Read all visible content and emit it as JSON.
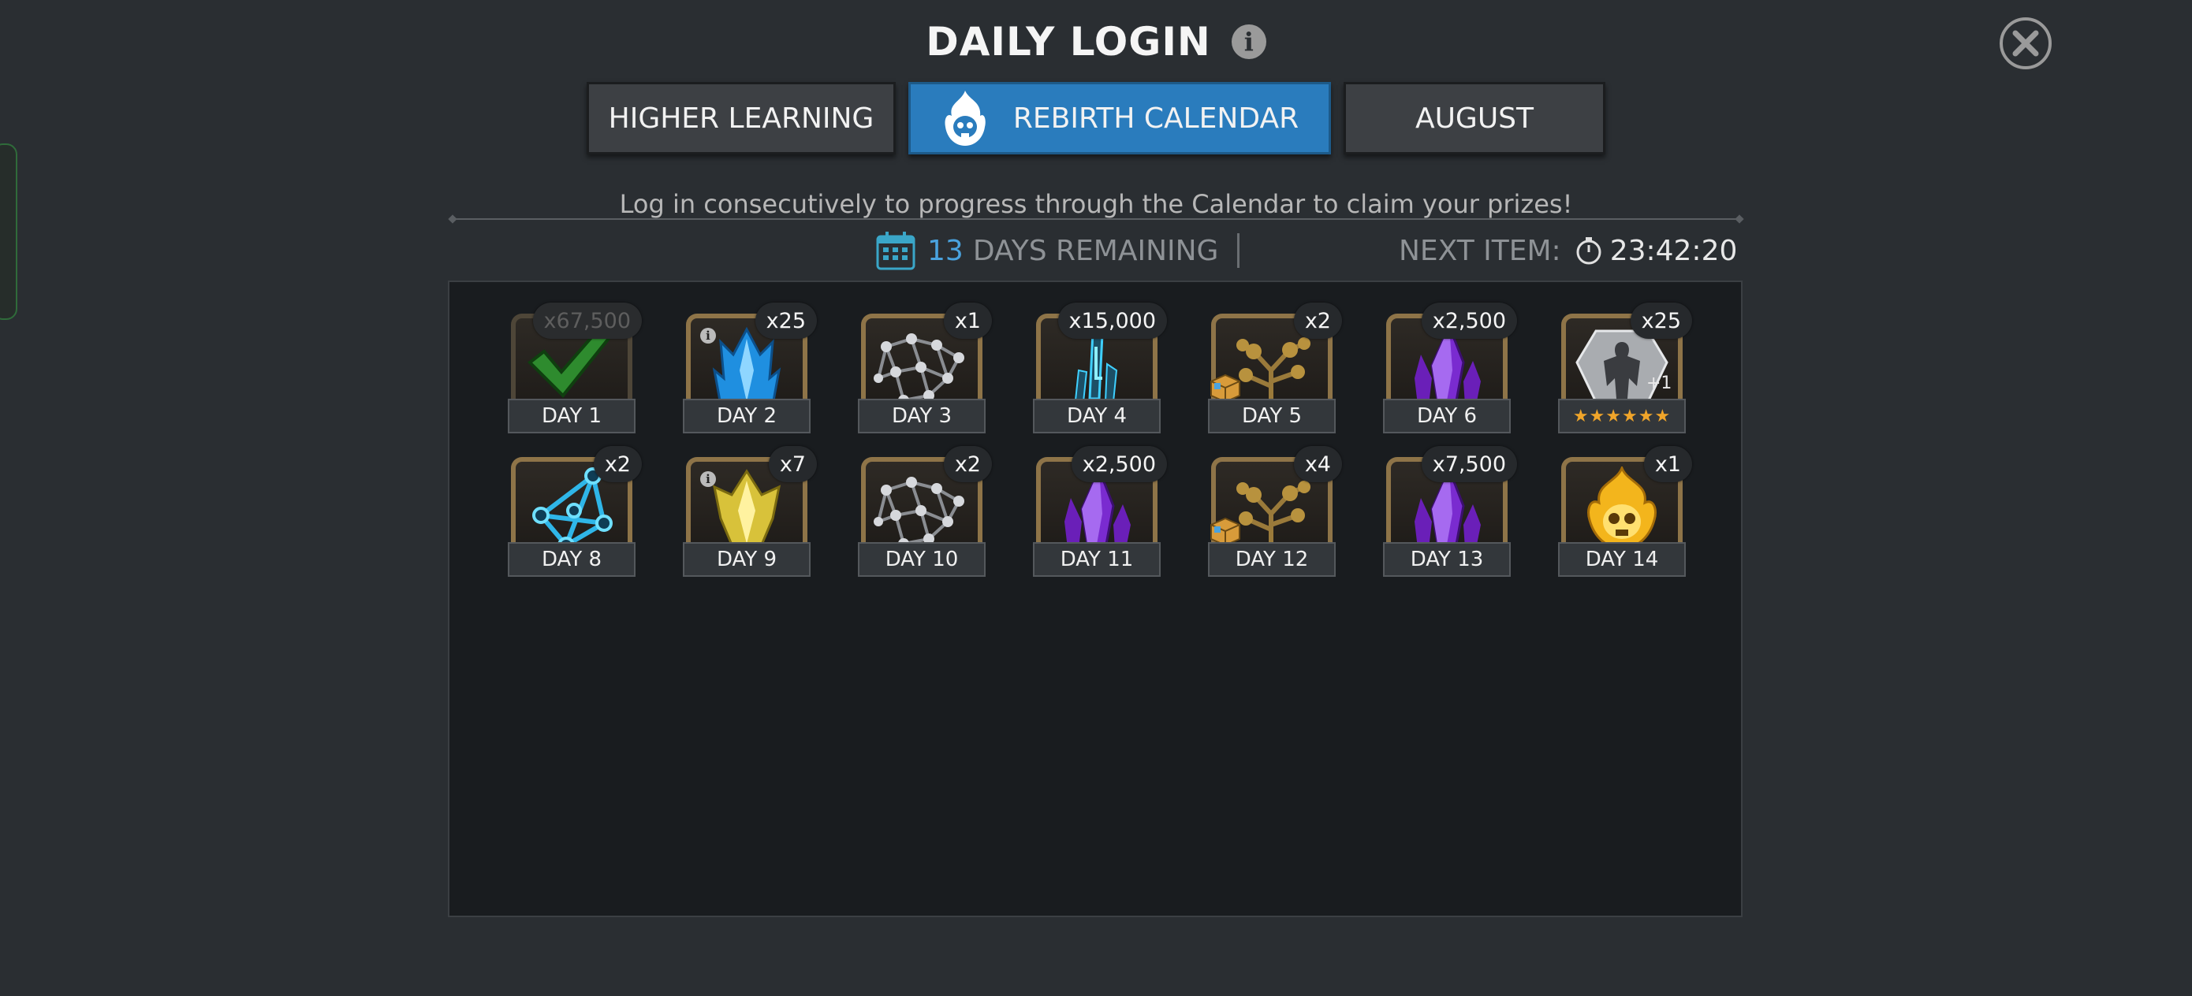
{
  "header": {
    "title": "DAILY LOGIN"
  },
  "tabs": [
    {
      "label": "HIGHER LEARNING"
    },
    {
      "label": "REBIRTH CALENDAR"
    },
    {
      "label": "AUGUST"
    }
  ],
  "subtitle": "Log in consecutively to progress through the Calendar to claim your prizes!",
  "status": {
    "days_remaining_number": "13",
    "days_remaining_label": "DAYS REMAINING",
    "next_item_label": "NEXT ITEM:",
    "next_item_time": "23:42:20"
  },
  "colors": {
    "accent_blue": "#2a7cbd",
    "frame_gold": "#8e7448",
    "star_orange": "#f0a52a"
  },
  "rewards": [
    {
      "day": "DAY 1",
      "qty": "x67,500",
      "icon": "gold-checkmark-claimed-icon",
      "claimed": true
    },
    {
      "day": "DAY 2",
      "qty": "x25",
      "icon": "blue-crystal-icon"
    },
    {
      "day": "DAY 3",
      "qty": "x1",
      "icon": "silver-node-web-icon"
    },
    {
      "day": "DAY 4",
      "qty": "x15,000",
      "icon": "cyan-shard-icon"
    },
    {
      "day": "DAY 5",
      "qty": "x2",
      "icon": "gold-catalyst-tree-icon"
    },
    {
      "day": "DAY 6",
      "qty": "x2,500",
      "icon": "purple-crystal-icon"
    },
    {
      "day": "",
      "stars_label": "★★★★★★",
      "qty": "x25",
      "icon": "champion-shard-icon",
      "badge": "+1"
    },
    {
      "day": "DAY 8",
      "qty": "x2",
      "icon": "blue-node-network-icon"
    },
    {
      "day": "DAY 9",
      "qty": "x7",
      "icon": "yellow-crystal-icon"
    },
    {
      "day": "DAY 10",
      "qty": "x2",
      "icon": "silver-node-web-icon"
    },
    {
      "day": "DAY 11",
      "qty": "x2,500",
      "icon": "purple-crystal-icon"
    },
    {
      "day": "DAY 12",
      "qty": "x4",
      "icon": "gold-catalyst-tree-icon"
    },
    {
      "day": "DAY 13",
      "qty": "x7,500",
      "icon": "purple-crystal-icon"
    },
    {
      "day": "DAY 14",
      "qty": "x1",
      "icon": "flaming-skull-icon"
    }
  ]
}
